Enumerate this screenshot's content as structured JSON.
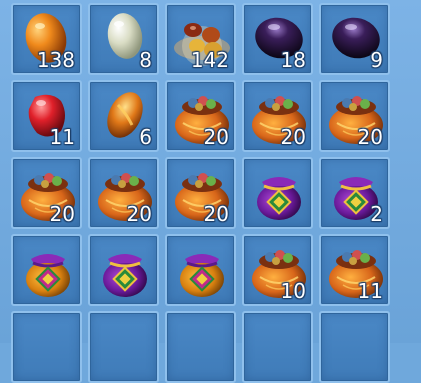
{
  "inventory": {
    "slots": [
      {
        "icon": "orange-egg-icon",
        "qty": "138"
      },
      {
        "icon": "pale-egg-icon",
        "qty": "8"
      },
      {
        "icon": "ore-pile-icon",
        "qty": "142"
      },
      {
        "icon": "dark-purple-egg-icon",
        "qty": "18"
      },
      {
        "icon": "dark-purple-egg-icon",
        "qty": "9"
      },
      {
        "icon": "red-gem-icon",
        "qty": "11"
      },
      {
        "icon": "orange-gem-icon",
        "qty": "6"
      },
      {
        "icon": "orange-loot-bag-icon",
        "qty": "20"
      },
      {
        "icon": "orange-loot-bag-icon",
        "qty": "20"
      },
      {
        "icon": "orange-loot-bag-icon",
        "qty": "20"
      },
      {
        "icon": "orange-loot-bag-icon",
        "qty": "20"
      },
      {
        "icon": "orange-loot-bag-icon",
        "qty": "20"
      },
      {
        "icon": "orange-loot-bag-icon",
        "qty": "20"
      },
      {
        "icon": "purple-pouch-icon",
        "qty": ""
      },
      {
        "icon": "purple-pouch-icon",
        "qty": "2"
      },
      {
        "icon": "gold-pouch-icon",
        "qty": ""
      },
      {
        "icon": "purple-pouch-icon",
        "qty": ""
      },
      {
        "icon": "gold-pouch-icon",
        "qty": ""
      },
      {
        "icon": "orange-loot-bag-icon",
        "qty": "10"
      },
      {
        "icon": "orange-loot-bag-icon",
        "qty": "11"
      },
      {
        "icon": "",
        "qty": ""
      },
      {
        "icon": "",
        "qty": ""
      },
      {
        "icon": "",
        "qty": ""
      },
      {
        "icon": "",
        "qty": ""
      },
      {
        "icon": "",
        "qty": ""
      }
    ]
  },
  "colors": {
    "slot_bg": "#4a88c6",
    "slot_border": "#8fc0ec",
    "panel_bg": "#6fa8dc"
  }
}
